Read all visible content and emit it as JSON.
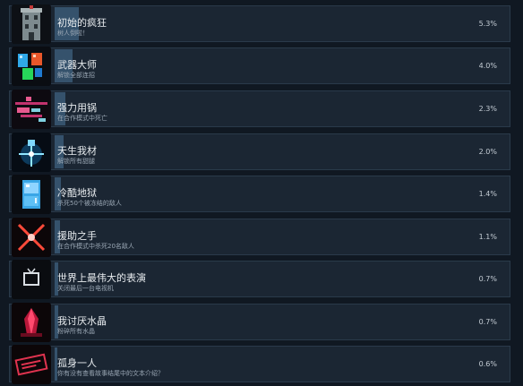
{
  "achievements": [
    {
      "title": "初始的疯狂",
      "desc": "树人倒啦！",
      "percent_label": "5.3%",
      "percent": 5.3,
      "icon": "tower-icon"
    },
    {
      "title": "武器大师",
      "desc": "解锁全部连招",
      "percent_label": "4.0%",
      "percent": 4.0,
      "icon": "weapons-icon"
    },
    {
      "title": "强力用锅",
      "desc": "在合作模式中死亡",
      "percent_label": "2.3%",
      "percent": 2.3,
      "icon": "pan-icon"
    },
    {
      "title": "天生我材",
      "desc": "解锁所有甜腿",
      "percent_label": "2.0%",
      "percent": 2.0,
      "icon": "glowing-figure-icon"
    },
    {
      "title": "冷酷地狱",
      "desc": "杀死50个被冻结的敌人",
      "percent_label": "1.4%",
      "percent": 1.4,
      "icon": "freezer-icon"
    },
    {
      "title": "援助之手",
      "desc": "在合作模式中杀死20名敌人",
      "percent_label": "1.1%",
      "percent": 1.1,
      "icon": "cross-slash-icon"
    },
    {
      "title": "世界上最伟大的表演",
      "desc": "关闭最后一台电视机",
      "percent_label": "0.7%",
      "percent": 0.7,
      "icon": "tv-icon"
    },
    {
      "title": "我讨厌水晶",
      "desc": "粉碎所有水晶",
      "percent_label": "0.7%",
      "percent": 0.7,
      "icon": "crystal-icon"
    },
    {
      "title": "孤身一人",
      "desc": "你有没有查看故事结尾中的文本介绍？",
      "percent_label": "0.6%",
      "percent": 0.6,
      "icon": "stamp-icon"
    }
  ]
}
